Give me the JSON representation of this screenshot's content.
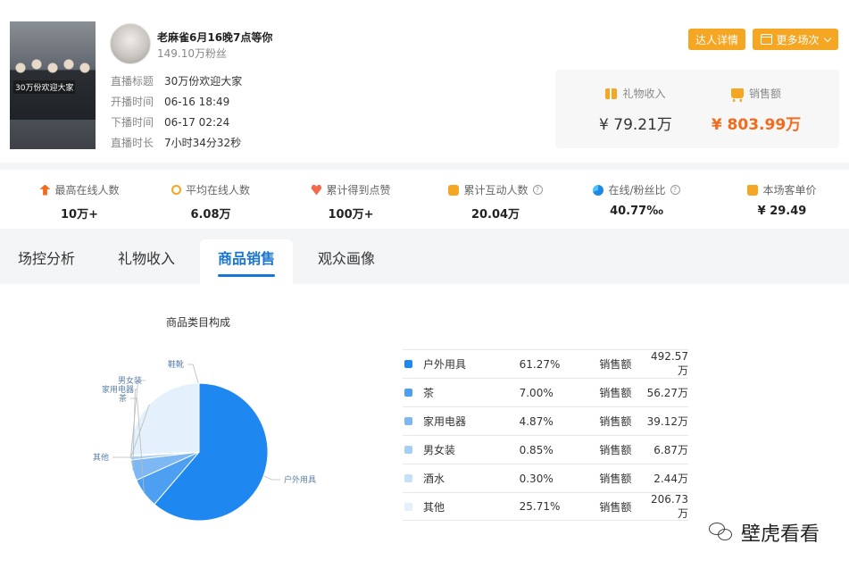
{
  "streamer": {
    "cover_text": "30万份欢迎大家",
    "name": "老麻雀6月16晚7点等你",
    "fans": "149.10万粉丝"
  },
  "info": [
    {
      "label": "直播标题",
      "value": "30万份欢迎大家"
    },
    {
      "label": "开播时间",
      "value": "06-16 18:49"
    },
    {
      "label": "下播时间",
      "value": "06-17 02:24"
    },
    {
      "label": "直播时长",
      "value": "7小时34分32秒"
    }
  ],
  "buttons": {
    "detail": "达人详情",
    "more": "更多场次"
  },
  "revenue": {
    "gift_label": "礼物收入",
    "gift_value": "¥ 79.21万",
    "sales_label": "销售额",
    "sales_value": "¥ 803.99万"
  },
  "stats": [
    {
      "label": "最高在线人数",
      "value": "10万+",
      "icon": "arrow-up-icon"
    },
    {
      "label": "平均在线人数",
      "value": "6.08万",
      "icon": "average-icon"
    },
    {
      "label": "累计得到点赞",
      "value": "100万+",
      "icon": "heart-icon"
    },
    {
      "label": "累计互动人数",
      "value": "20.04万",
      "icon": "chat-icon"
    },
    {
      "label": "在线/粉丝比",
      "value": "40.77‰",
      "icon": "pie-icon"
    },
    {
      "label": "本场客单价",
      "value": "¥ 29.49",
      "icon": "bag-icon"
    }
  ],
  "tabs": [
    "场控分析",
    "礼物收入",
    "商品销售",
    "观众画像"
  ],
  "active_tab": "商品销售",
  "colors": {
    "accent": "#1976d2",
    "orange": "#f5a623",
    "price": "#f26b1d"
  },
  "chart_data": {
    "type": "pie",
    "title": "商品类目构成",
    "slices": [
      {
        "name": "户外用具",
        "value": 61.27,
        "pct": "61.27%",
        "amount": "492.57万",
        "color": "#1e88f0"
      },
      {
        "name": "茶",
        "value": 7.0,
        "pct": "7.00%",
        "amount": "56.27万",
        "color": "#4d9ff2"
      },
      {
        "name": "家用电器",
        "value": 4.87,
        "pct": "4.87%",
        "amount": "39.12万",
        "color": "#7db8f5"
      },
      {
        "name": "男女装",
        "value": 0.85,
        "pct": "0.85%",
        "amount": "6.87万",
        "color": "#a6cff8"
      },
      {
        "name": "酒水",
        "value": 0.3,
        "pct": "0.30%",
        "amount": "2.44万",
        "color": "#c6e0fa"
      },
      {
        "name": "其他",
        "value": 25.71,
        "pct": "25.71%",
        "amount": "206.73万",
        "color": "#e4f0fc"
      }
    ],
    "small_label": "鞋靴",
    "amount_label": "销售额"
  },
  "watermark": "壁虎看看"
}
